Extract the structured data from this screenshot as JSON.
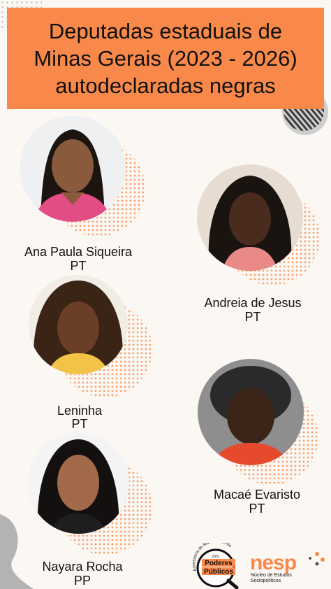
{
  "title": "Deputadas estaduais de Minas Gerais (2023 - 2026) autodeclaradas negras",
  "deputies": [
    {
      "name": "Ana Paula Siqueira",
      "party": "PT"
    },
    {
      "name": "Andreia de Jesus",
      "party": "PT"
    },
    {
      "name": "Leninha",
      "party": "PT"
    },
    {
      "name": "Macaé Evaristo",
      "party": "PT"
    },
    {
      "name": "Nayara Rocha",
      "party": "PP"
    }
  ],
  "logos": {
    "poderes_arc": "Assessoria de Monitoramento",
    "poderes_small": "dos",
    "poderes_line1": "Poderes",
    "poderes_line2": "Públicos",
    "nesp_word": "nesp",
    "nesp_line1": "Núcleo de Estudos",
    "nesp_line2": "Sociopolíticos"
  },
  "colors": {
    "accent": "#f9894a",
    "background": "#fbf7f3",
    "halo": "#f7a16e",
    "gray_shape": "#b3b3b3"
  }
}
